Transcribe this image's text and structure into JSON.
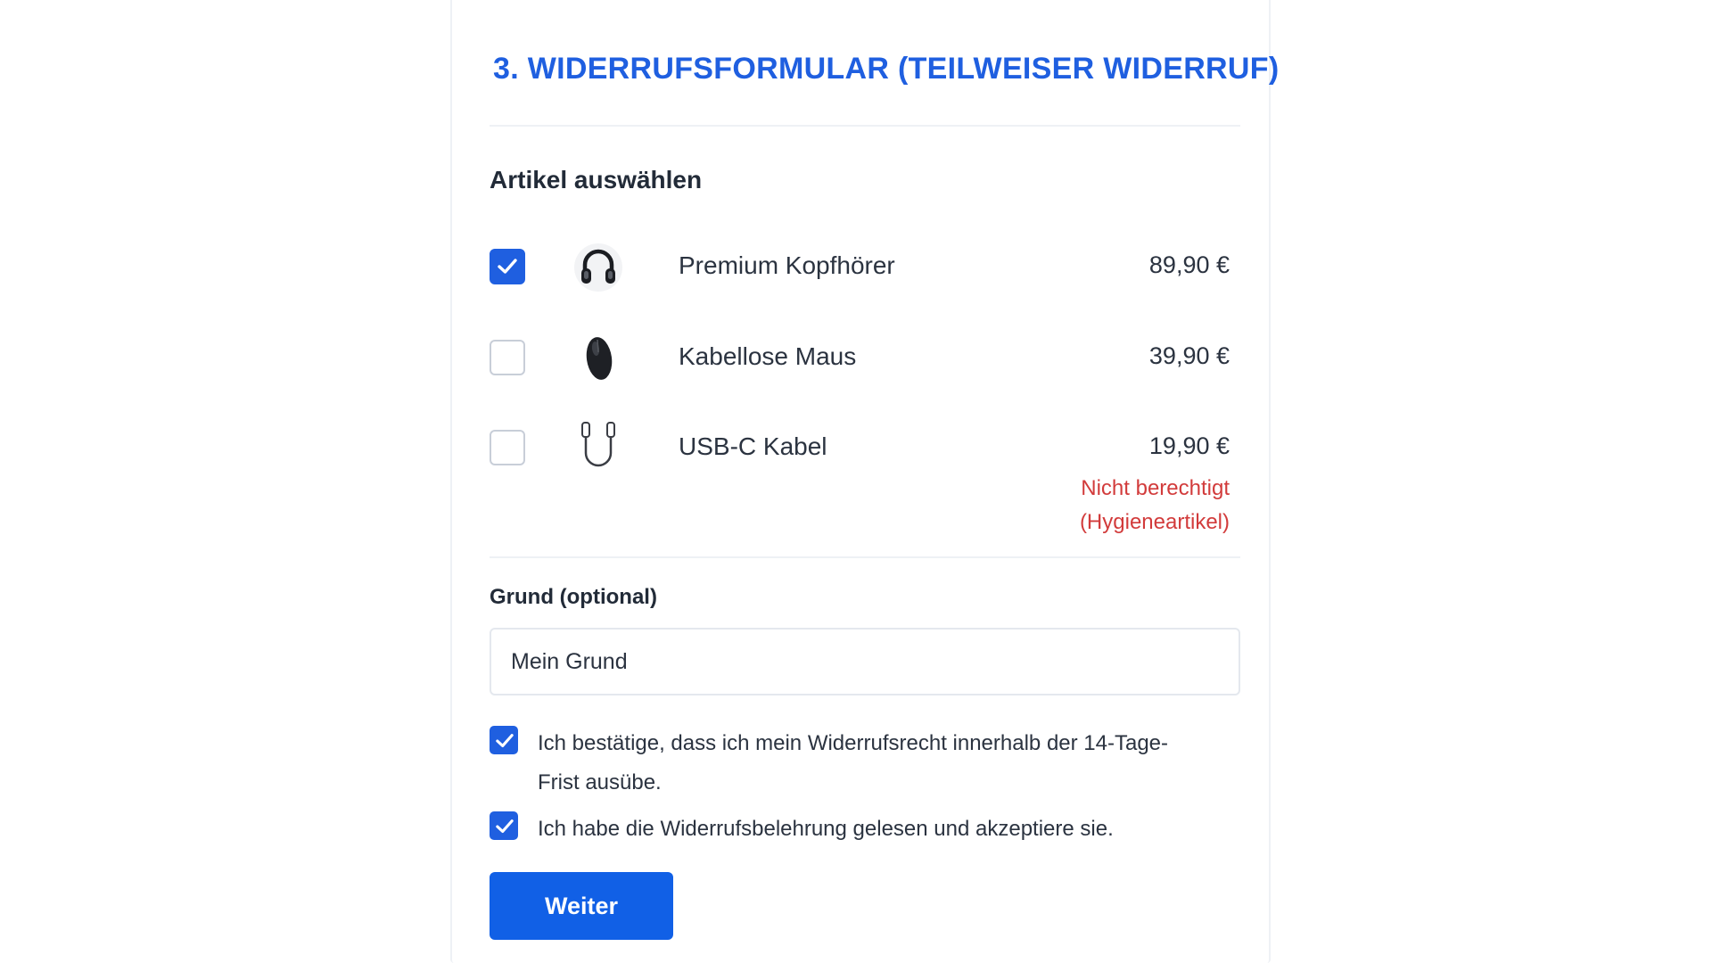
{
  "form": {
    "title": "3. WIDERRUFSFORMULAR (TEILWEISER WIDERRUF)",
    "section_title": "Artikel auswählen",
    "items": [
      {
        "name": "Premium Kopfhörer",
        "price": "89,90 €",
        "checked": true,
        "icon": "headphones-icon",
        "note": ""
      },
      {
        "name": "Kabellose Maus",
        "price": "39,90 €",
        "checked": false,
        "icon": "mouse-icon",
        "note": ""
      },
      {
        "name": "USB-C Kabel",
        "price": "19,90 €",
        "checked": false,
        "icon": "usb-c-cable-icon",
        "note": "Nicht berechtigt (Hygieneartikel)"
      }
    ],
    "reason": {
      "label": "Grund (optional)",
      "value": "Mein Grund"
    },
    "confirmations": [
      {
        "text": "Ich bestätige, dass ich mein Widerrufsrecht innerhalb der 14-Tage-Frist ausübe.",
        "checked": true
      },
      {
        "text": "Ich habe die Widerrufsbelehrung gelesen und akzeptiere sie.",
        "checked": true
      }
    ],
    "next_label": "Weiter"
  },
  "colors": {
    "accent": "#1f5fe0",
    "button": "#1160e6",
    "error": "#d23b3b"
  }
}
